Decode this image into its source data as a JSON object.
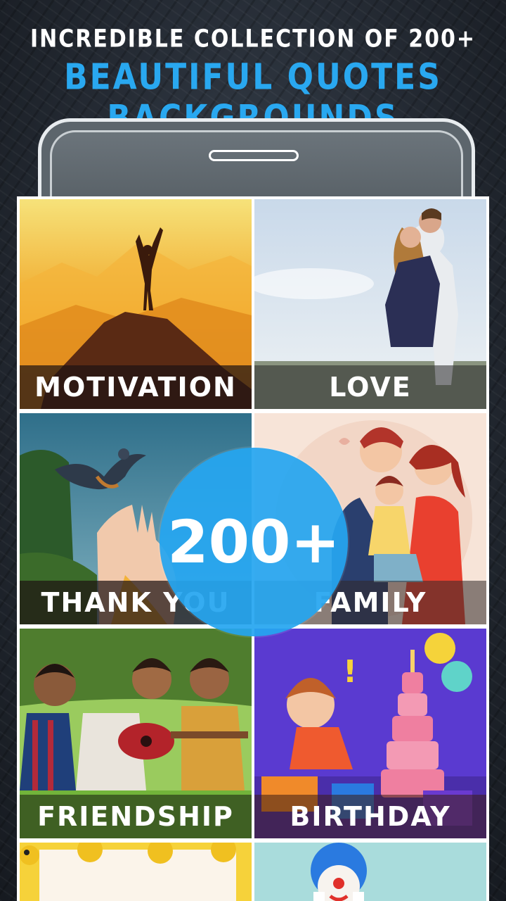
{
  "header": {
    "line1": "INCREDIBLE COLLECTION OF 200+",
    "line2": "BEAUTIFUL QUOTES BACKGROUNDS"
  },
  "badge": {
    "text": "200+"
  },
  "categories": [
    {
      "label": "MOTIVATION"
    },
    {
      "label": "LOVE"
    },
    {
      "label": "THANK YOU"
    },
    {
      "label": "FAMILY"
    },
    {
      "label": "FRIENDSHIP"
    },
    {
      "label": "BIRTHDAY"
    }
  ],
  "colors": {
    "accent": "#29a8f0",
    "badge": "#26a6f0",
    "label_bar": "#1e1414"
  }
}
